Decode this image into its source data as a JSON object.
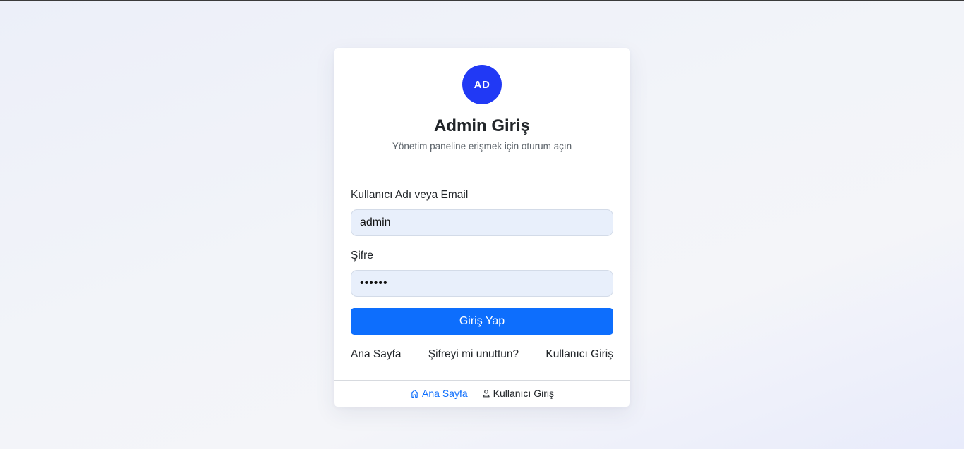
{
  "header": {
    "avatar_text": "AD",
    "title": "Admin Giriş",
    "subtitle": "Yönetim paneline erişmek için oturum açın"
  },
  "form": {
    "username_label": "Kullanıcı Adı veya Email",
    "username_value": "admin",
    "password_label": "Şifre",
    "password_value": "••••••",
    "submit_label": "Giriş Yap"
  },
  "links": {
    "home": "Ana Sayfa",
    "forgot": "Şifreyi mi unuttun?",
    "user_login": "Kullanıcı Giriş"
  },
  "footer": {
    "home_label": "Ana Sayfa",
    "home_icon": "home-icon",
    "user_label": "Kullanıcı Giriş",
    "user_icon": "person-icon"
  },
  "colors": {
    "primary": "#0d6efd",
    "avatar": "#2139f5",
    "input_bg": "#e8effb"
  }
}
